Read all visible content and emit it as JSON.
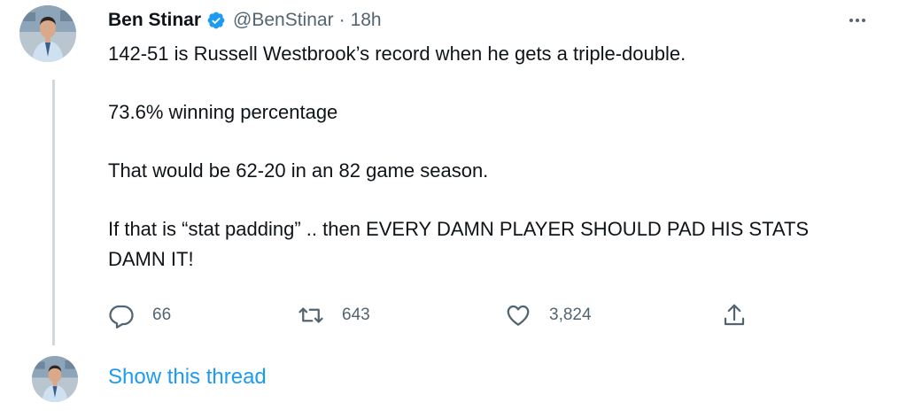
{
  "tweet": {
    "display_name": "Ben Stinar",
    "handle": "@BenStinar",
    "separator": "·",
    "time": "18h",
    "paragraphs": [
      "142-51 is Russell Westbrook’s record when he gets a triple-double.",
      "73.6% winning percentage",
      "That would be 62-20 in an 82 game season.",
      "If that is “stat padding” .. then EVERY DAMN PLAYER SHOULD PAD HIS STATS DAMN IT!"
    ],
    "actions": {
      "replies": "66",
      "retweets": "643",
      "likes": "3,824"
    },
    "icons": {
      "verified": "verified-badge-icon",
      "more": "more-options-icon",
      "reply": "reply-icon",
      "retweet": "retweet-icon",
      "like": "heart-icon",
      "share": "share-icon"
    }
  },
  "thread": {
    "link_label": "Show this thread"
  },
  "colors": {
    "text_primary": "#0f1419",
    "text_secondary": "#536471",
    "link": "#1d9bf0",
    "verified": "#1d9bf0",
    "thread_line": "#cfd9de"
  }
}
